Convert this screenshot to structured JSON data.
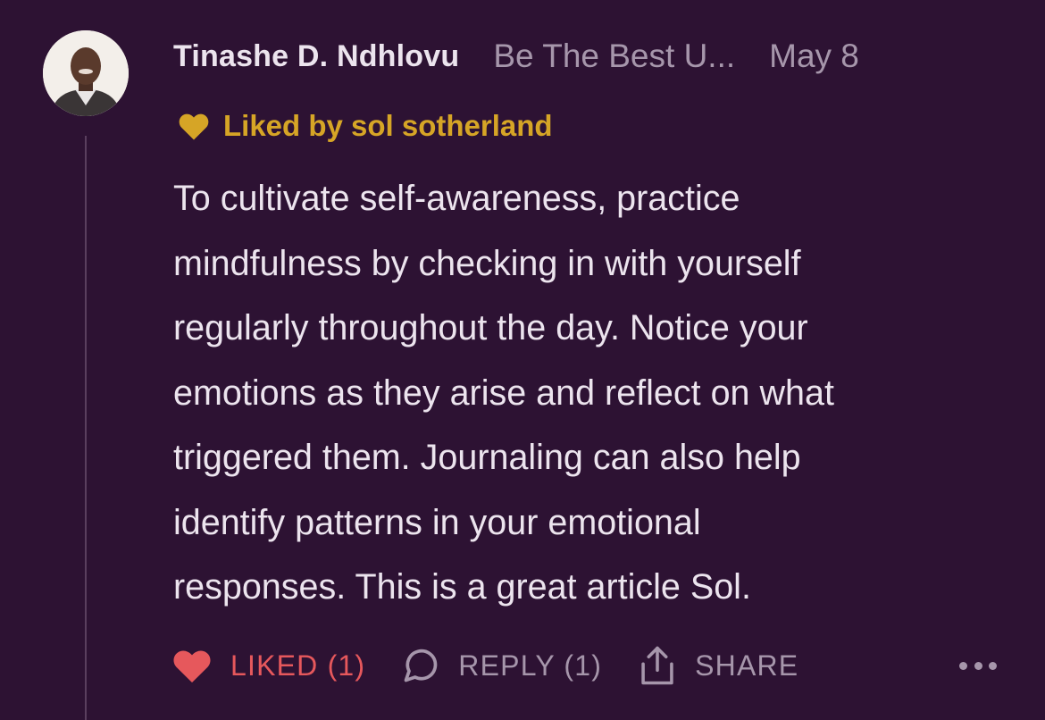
{
  "comment": {
    "author": "Tinashe D. Ndhlovu",
    "publication": "Be The Best U...",
    "date": "May 8",
    "liked_by": "Liked by sol sotherland",
    "body_lines": [
      "To cultivate self-awareness, practice",
      "mindfulness by checking in with yourself",
      "regularly throughout the day. Notice your",
      "emotions as they arise and reflect on what",
      "triggered them. Journaling can also help",
      "identify patterns in your emotional",
      "responses. This is a great article Sol."
    ],
    "actions": {
      "like_label": "LIKED (1)",
      "reply_label": "REPLY (1)",
      "share_label": "SHARE"
    }
  },
  "colors": {
    "background": "#2d1233",
    "text_primary": "#ece4ee",
    "text_muted": "#a696ab",
    "liked_by_accent": "#d6a526",
    "like_accent": "#e6585c"
  },
  "icons": {
    "liked_by": "heart-icon",
    "like": "heart-filled-icon",
    "reply": "speech-bubble-icon",
    "share": "share-upload-icon",
    "more": "more-horizontal-icon"
  }
}
